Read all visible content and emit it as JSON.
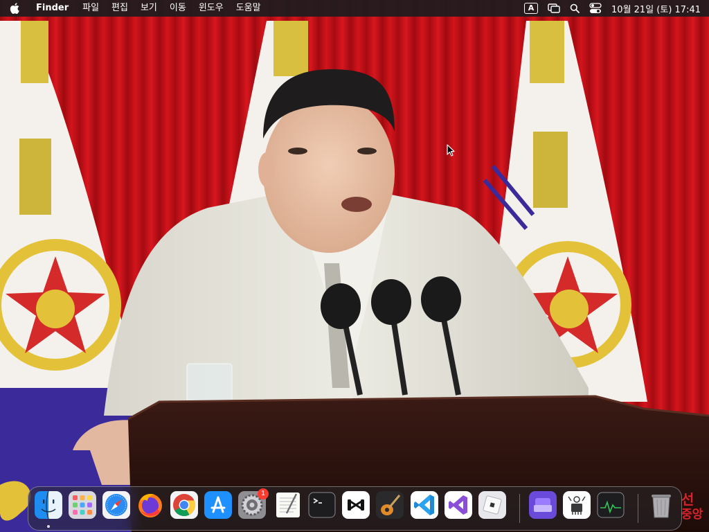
{
  "menubar": {
    "app_name": "Finder",
    "menus": [
      "파일",
      "편집",
      "보기",
      "이동",
      "윈도우",
      "도움말"
    ],
    "input_source": "A",
    "clock": "10월 21일 (토) 17:41"
  },
  "desktop": {
    "wallpaper_corner_text": [
      "선",
      "중앙"
    ]
  },
  "dock": {
    "apps": [
      {
        "name": "Finder",
        "running": true
      },
      {
        "name": "Launchpad"
      },
      {
        "name": "Safari"
      },
      {
        "name": "Firefox"
      },
      {
        "name": "Google Chrome"
      },
      {
        "name": "App Store"
      },
      {
        "name": "System Settings",
        "badge": "1"
      },
      {
        "name": "TextEdit"
      },
      {
        "name": "Terminal"
      },
      {
        "name": "CapCut"
      },
      {
        "name": "GarageBand"
      },
      {
        "name": "Visual Studio Code"
      },
      {
        "name": "Visual Studio"
      },
      {
        "name": "Roblox"
      },
      {
        "name": "Downloads stack"
      },
      {
        "name": "System Information"
      },
      {
        "name": "Activity Monitor"
      },
      {
        "name": "Trash"
      }
    ]
  },
  "colors": {
    "menubar_bg": "#1c1c1e",
    "curtain_red": "#c8101a",
    "flag_blue": "#3a2a9a",
    "emblem_gold": "#e3c23a",
    "badge_red": "#ff3b30"
  }
}
